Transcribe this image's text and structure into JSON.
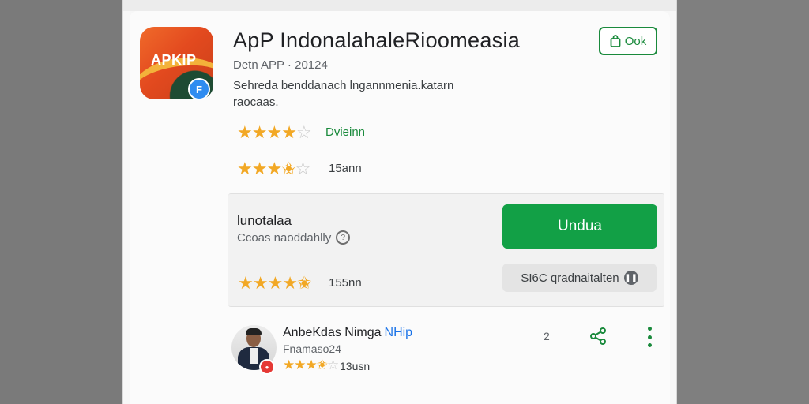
{
  "app": {
    "title": "ApP  IndonalahaleRioomeasia",
    "subtitle": "Detn APP · 20124",
    "description": "Sehreda benddanach lngannmenia.katarn raocaas.",
    "icon_text": "APKIP",
    "badge_icon": "F"
  },
  "header_button": {
    "label": "Ook",
    "icon": "bag-icon"
  },
  "ratings": [
    {
      "stars": 4,
      "label": "Dvieinn"
    },
    {
      "stars": 3.5,
      "label": "15ann"
    }
  ],
  "install_panel": {
    "title": "lunotalaa",
    "subtitle": "Ccoas naoddahlly",
    "primary_button": "Undua",
    "secondary_button": "SI6C qradnaitalten",
    "rating": {
      "stars": 4.5,
      "label": "155nn"
    }
  },
  "review": {
    "name": "AnbeKdas Nimga",
    "tag": "NHip",
    "date": "Fnamaso24",
    "stars": 3.5,
    "stars_label": "13usn",
    "count": "2"
  },
  "colors": {
    "accent": "#12a046",
    "star": "#f2a825",
    "link": "#1a73e8"
  }
}
